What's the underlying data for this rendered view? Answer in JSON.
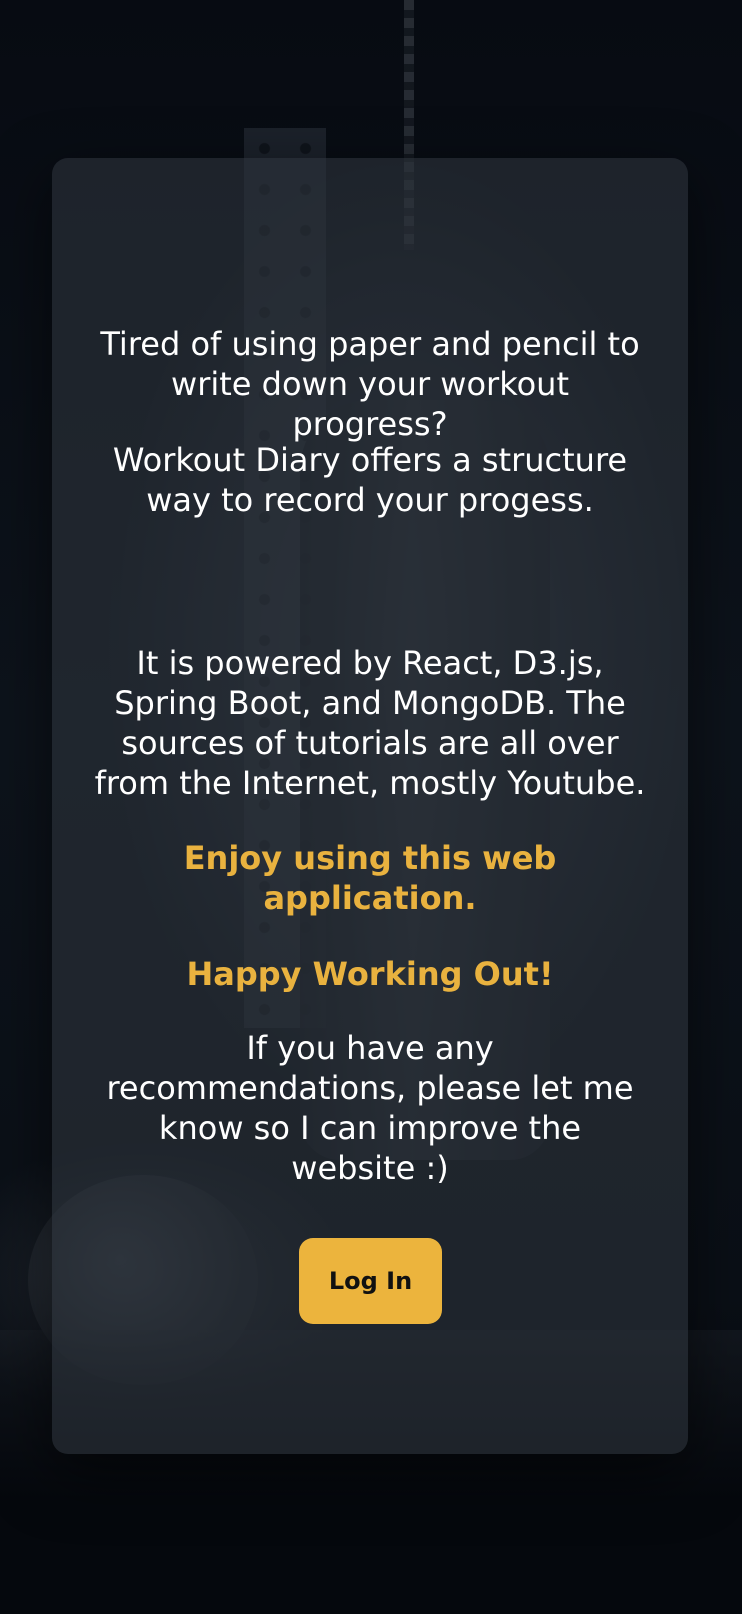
{
  "landing": {
    "intro": "Tired of using paper and pencil to write down your workout progress?",
    "offer": "Workout Diary offers a structure way to record your progess.",
    "powered": "It is powered by React, D3.js, Spring Boot, and MongoDB. The sources of tutorials are all over from the Internet, mostly Youtube.",
    "enjoy": "Enjoy using this web application.",
    "happy": "Happy Working Out!",
    "recommend": "If you have any recommendations, please let me know so I can improve the website :)",
    "login_label": "Log In"
  },
  "colors": {
    "accent": "#ecb43d",
    "highlight_text": "#e9b23f",
    "card_bg": "rgba(44,50,58,0.62)",
    "page_bg": "#0b1018"
  }
}
